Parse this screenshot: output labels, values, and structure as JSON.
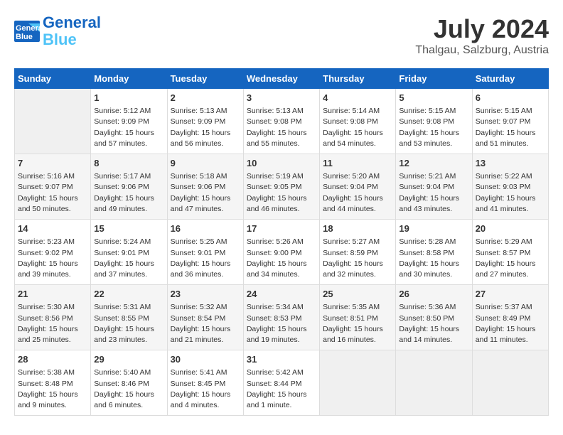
{
  "header": {
    "logo_line1": "General",
    "logo_line2": "Blue",
    "month_year": "July 2024",
    "location": "Thalgau, Salzburg, Austria"
  },
  "columns": [
    "Sunday",
    "Monday",
    "Tuesday",
    "Wednesday",
    "Thursday",
    "Friday",
    "Saturday"
  ],
  "weeks": [
    [
      {
        "day": "",
        "info": ""
      },
      {
        "day": "1",
        "info": "Sunrise: 5:12 AM\nSunset: 9:09 PM\nDaylight: 15 hours\nand 57 minutes."
      },
      {
        "day": "2",
        "info": "Sunrise: 5:13 AM\nSunset: 9:09 PM\nDaylight: 15 hours\nand 56 minutes."
      },
      {
        "day": "3",
        "info": "Sunrise: 5:13 AM\nSunset: 9:08 PM\nDaylight: 15 hours\nand 55 minutes."
      },
      {
        "day": "4",
        "info": "Sunrise: 5:14 AM\nSunset: 9:08 PM\nDaylight: 15 hours\nand 54 minutes."
      },
      {
        "day": "5",
        "info": "Sunrise: 5:15 AM\nSunset: 9:08 PM\nDaylight: 15 hours\nand 53 minutes."
      },
      {
        "day": "6",
        "info": "Sunrise: 5:15 AM\nSunset: 9:07 PM\nDaylight: 15 hours\nand 51 minutes."
      }
    ],
    [
      {
        "day": "7",
        "info": "Sunrise: 5:16 AM\nSunset: 9:07 PM\nDaylight: 15 hours\nand 50 minutes."
      },
      {
        "day": "8",
        "info": "Sunrise: 5:17 AM\nSunset: 9:06 PM\nDaylight: 15 hours\nand 49 minutes."
      },
      {
        "day": "9",
        "info": "Sunrise: 5:18 AM\nSunset: 9:06 PM\nDaylight: 15 hours\nand 47 minutes."
      },
      {
        "day": "10",
        "info": "Sunrise: 5:19 AM\nSunset: 9:05 PM\nDaylight: 15 hours\nand 46 minutes."
      },
      {
        "day": "11",
        "info": "Sunrise: 5:20 AM\nSunset: 9:04 PM\nDaylight: 15 hours\nand 44 minutes."
      },
      {
        "day": "12",
        "info": "Sunrise: 5:21 AM\nSunset: 9:04 PM\nDaylight: 15 hours\nand 43 minutes."
      },
      {
        "day": "13",
        "info": "Sunrise: 5:22 AM\nSunset: 9:03 PM\nDaylight: 15 hours\nand 41 minutes."
      }
    ],
    [
      {
        "day": "14",
        "info": "Sunrise: 5:23 AM\nSunset: 9:02 PM\nDaylight: 15 hours\nand 39 minutes."
      },
      {
        "day": "15",
        "info": "Sunrise: 5:24 AM\nSunset: 9:01 PM\nDaylight: 15 hours\nand 37 minutes."
      },
      {
        "day": "16",
        "info": "Sunrise: 5:25 AM\nSunset: 9:01 PM\nDaylight: 15 hours\nand 36 minutes."
      },
      {
        "day": "17",
        "info": "Sunrise: 5:26 AM\nSunset: 9:00 PM\nDaylight: 15 hours\nand 34 minutes."
      },
      {
        "day": "18",
        "info": "Sunrise: 5:27 AM\nSunset: 8:59 PM\nDaylight: 15 hours\nand 32 minutes."
      },
      {
        "day": "19",
        "info": "Sunrise: 5:28 AM\nSunset: 8:58 PM\nDaylight: 15 hours\nand 30 minutes."
      },
      {
        "day": "20",
        "info": "Sunrise: 5:29 AM\nSunset: 8:57 PM\nDaylight: 15 hours\nand 27 minutes."
      }
    ],
    [
      {
        "day": "21",
        "info": "Sunrise: 5:30 AM\nSunset: 8:56 PM\nDaylight: 15 hours\nand 25 minutes."
      },
      {
        "day": "22",
        "info": "Sunrise: 5:31 AM\nSunset: 8:55 PM\nDaylight: 15 hours\nand 23 minutes."
      },
      {
        "day": "23",
        "info": "Sunrise: 5:32 AM\nSunset: 8:54 PM\nDaylight: 15 hours\nand 21 minutes."
      },
      {
        "day": "24",
        "info": "Sunrise: 5:34 AM\nSunset: 8:53 PM\nDaylight: 15 hours\nand 19 minutes."
      },
      {
        "day": "25",
        "info": "Sunrise: 5:35 AM\nSunset: 8:51 PM\nDaylight: 15 hours\nand 16 minutes."
      },
      {
        "day": "26",
        "info": "Sunrise: 5:36 AM\nSunset: 8:50 PM\nDaylight: 15 hours\nand 14 minutes."
      },
      {
        "day": "27",
        "info": "Sunrise: 5:37 AM\nSunset: 8:49 PM\nDaylight: 15 hours\nand 11 minutes."
      }
    ],
    [
      {
        "day": "28",
        "info": "Sunrise: 5:38 AM\nSunset: 8:48 PM\nDaylight: 15 hours\nand 9 minutes."
      },
      {
        "day": "29",
        "info": "Sunrise: 5:40 AM\nSunset: 8:46 PM\nDaylight: 15 hours\nand 6 minutes."
      },
      {
        "day": "30",
        "info": "Sunrise: 5:41 AM\nSunset: 8:45 PM\nDaylight: 15 hours\nand 4 minutes."
      },
      {
        "day": "31",
        "info": "Sunrise: 5:42 AM\nSunset: 8:44 PM\nDaylight: 15 hours\nand 1 minute."
      },
      {
        "day": "",
        "info": ""
      },
      {
        "day": "",
        "info": ""
      },
      {
        "day": "",
        "info": ""
      }
    ]
  ]
}
